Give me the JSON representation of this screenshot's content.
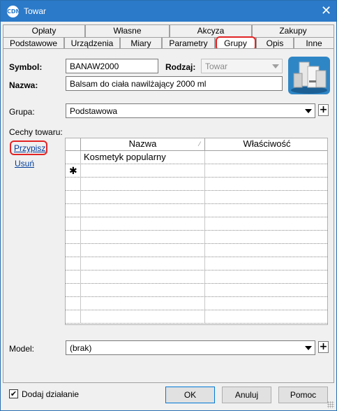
{
  "window": {
    "title": "Towar",
    "app_icon": "comarch-optima-icon"
  },
  "tabs_row1": [
    {
      "label": "Opłaty"
    },
    {
      "label": "Własne"
    },
    {
      "label": "Akcyza"
    },
    {
      "label": "Zakupy"
    }
  ],
  "tabs_row2": [
    {
      "label": "Podstawowe"
    },
    {
      "label": "Urządzenia"
    },
    {
      "label": "Miary"
    },
    {
      "label": "Parametry"
    },
    {
      "label": "Grupy",
      "active": true
    },
    {
      "label": "Opis"
    },
    {
      "label": "Inne"
    }
  ],
  "form": {
    "symbol_label": "Symbol:",
    "symbol_value": "BANAW2000",
    "rodzaj_label": "Rodzaj:",
    "rodzaj_value": "Towar",
    "nazwa_label": "Nazwa:",
    "nazwa_value": "Balsam do ciała nawilżający 2000 ml",
    "grupa_label": "Grupa:",
    "grupa_value": "Podstawowa",
    "cechy_label": "Cechy towaru:",
    "przypisz_link": "Przypisz",
    "usun_link": "Usuń",
    "model_label": "Model:",
    "model_value": "(brak)"
  },
  "grid": {
    "columns": [
      "Nazwa",
      "Właściwość"
    ],
    "rows": [
      {
        "nazwa": "Kosmetyk popularny",
        "wlasciwosc": ""
      }
    ],
    "new_row_marker": "✱"
  },
  "footer": {
    "checkbox_label": "Dodaj działanie",
    "checkbox_checked": true,
    "checkbox_mark": "✔",
    "ok_label": "OK",
    "cancel_label": "Anuluj",
    "help_label": "Pomoc"
  },
  "highlight_color": "#e22424",
  "titlebar_color": "#2b7ac9"
}
